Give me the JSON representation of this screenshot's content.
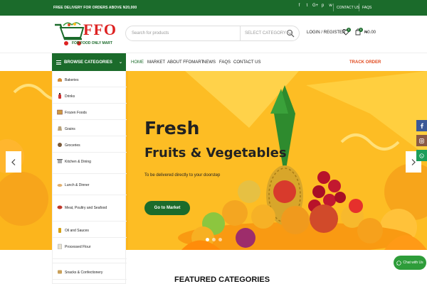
{
  "topbar": {
    "promo": "FREE DELIVERY FOR ORDERS ABOVE N20,000",
    "social": [
      "f",
      "t",
      "G+",
      "p",
      "w"
    ],
    "links": [
      "CONTACT US",
      "FAQS"
    ]
  },
  "header": {
    "logo_text": "FFO",
    "logo_tagline": "FOR FOOD ONLY MART",
    "search_placeholder": "Search for products",
    "category_select": "SELECT CATEGORY",
    "login": "LOGIN / REGISTER",
    "wishlist_count": "0",
    "cart_count": "0",
    "cart_amount": "₦0.00"
  },
  "nav": {
    "browse": "BROWSE CATEGORIES",
    "items": [
      "HOME",
      "MARKET",
      "ABOUT FFOMART",
      "NEWS",
      "FAQS",
      "CONTACT US"
    ],
    "track": "TRACK ORDER"
  },
  "categories": [
    "Bakeries",
    "Drinks",
    "Frozen Foods",
    "Grains",
    "Groceries",
    "Kitchen & Dining",
    "Lunch & Dinner",
    "Meat, Poultry and Seafood",
    "Oil and Sauces",
    "Processed Flour",
    "Snacks & Confectionery"
  ],
  "hero": {
    "title_line1": "Fresh",
    "title_line2": "Fruits & Vegetables",
    "subtitle": "To be delivered directly to your doorstep",
    "cta": "Go to Market"
  },
  "floating": {
    "chat": "Chat with Us"
  },
  "section": {
    "featured": "FEATURED CATEGORIES"
  },
  "colors": {
    "brand_green": "#1b6b2b",
    "hero_yellow": "#fdbd24",
    "accent_orange": "#e14a1f"
  }
}
